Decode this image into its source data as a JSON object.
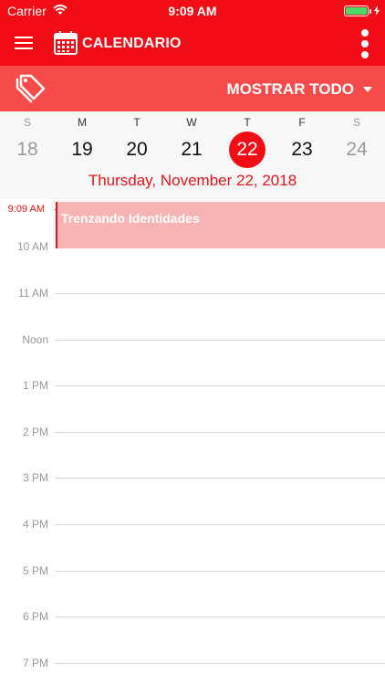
{
  "status_bar": {
    "carrier": "Carrier",
    "time": "9:09 AM",
    "icons": [
      "wifi-icon",
      "battery-icon",
      "charging-bolt-icon"
    ]
  },
  "nav": {
    "title": "CALENDARIO",
    "icons": [
      "menu-icon",
      "calendar-icon",
      "more-vertical-icon"
    ]
  },
  "filter": {
    "label": "MOSTRAR TODO",
    "icons": [
      "tag-icon",
      "caret-down-icon"
    ]
  },
  "week": {
    "days": [
      {
        "dow": "S",
        "num": "18"
      },
      {
        "dow": "M",
        "num": "19"
      },
      {
        "dow": "T",
        "num": "20"
      },
      {
        "dow": "W",
        "num": "21"
      },
      {
        "dow": "T",
        "num": "22"
      },
      {
        "dow": "F",
        "num": "23"
      },
      {
        "dow": "S",
        "num": "24"
      }
    ],
    "selected_date": "Thursday, November 22, 2018"
  },
  "timeline": {
    "now_label": "9:09 AM",
    "hours": [
      "10 AM",
      "11 AM",
      "Noon",
      "1 PM",
      "2 PM",
      "3 PM",
      "4 PM",
      "5 PM",
      "6 PM",
      "7 PM"
    ]
  },
  "event": {
    "title": "Trenzando Identidades"
  },
  "colors": {
    "primary": "#f20d16",
    "filter_bar": "#f74b4b",
    "event_fill": "#f8b4b4",
    "accent_text": "#e5121c"
  }
}
